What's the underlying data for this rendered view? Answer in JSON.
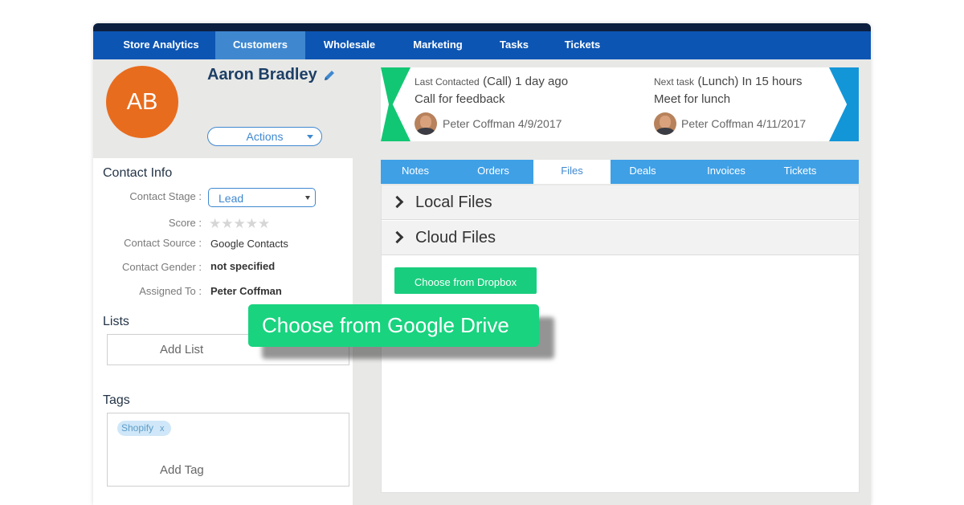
{
  "nav": {
    "items": [
      "Store Analytics",
      "Customers",
      "Wholesale",
      "Marketing",
      "Tasks",
      "Tickets"
    ],
    "active": "Customers"
  },
  "customer": {
    "initials": "AB",
    "name": "Aaron Bradley",
    "actions_label": "Actions"
  },
  "contact_info": {
    "title": "Contact Info",
    "stage_label": "Contact Stage :",
    "stage_value": "Lead",
    "score_label": "Score :",
    "score_stars": 0,
    "source_label": "Contact Source :",
    "source_value": "Google Contacts",
    "gender_label": "Contact Gender :",
    "gender_value": "not specified",
    "assigned_label": "Assigned To :",
    "assigned_value": "Peter Coffman"
  },
  "lists": {
    "title": "Lists",
    "add_label": "Add List"
  },
  "tags": {
    "title": "Tags",
    "items": [
      "Shopify"
    ],
    "remove_glyph": "x",
    "add_label": "Add Tag"
  },
  "banner": {
    "last": {
      "prefix": "Last Contacted",
      "type": "(Call) 1 day ago",
      "subject": "Call for feedback",
      "person": "Peter Coffman 4/9/2017"
    },
    "next": {
      "prefix": "Next task",
      "type": "(Lunch) In 15 hours",
      "subject": "Meet for lunch",
      "person": "Peter Coffman 4/11/2017"
    },
    "colors": {
      "left_flag": "#12c773",
      "right_flag": "#1296d8"
    }
  },
  "detail_tabs": {
    "items": [
      "Notes",
      "Orders",
      "Files",
      "Deals",
      "Invoices",
      "Tickets"
    ],
    "active": "Files"
  },
  "files": {
    "local_label": "Local Files",
    "cloud_label": "Cloud Files",
    "dropbox_label": "Choose from Dropbox",
    "gdrive_label": "Choose from Google Drive"
  },
  "colors": {
    "nav_bg": "#0d55b3",
    "nav_active": "#3f88d0",
    "avatar": "#e86c1e",
    "tabs_bg": "#3fa0e6",
    "green_button": "#19cd7e"
  }
}
